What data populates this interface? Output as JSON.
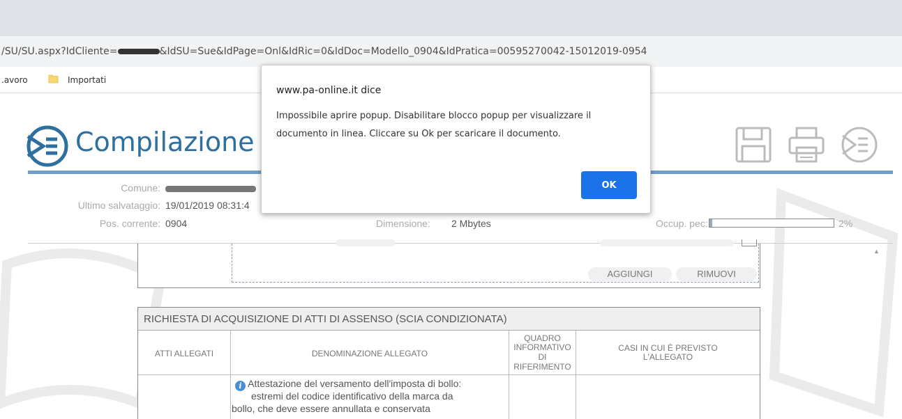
{
  "browser": {
    "url_prefix": "/SU/SU.aspx?IdCliente=",
    "url_suffix": "&IdSU=Sue&IdPage=Onl&IdRic=0&IdDoc=Modello_0904&IdPratica=00595270042-15012019-0954",
    "bookmarks": [
      ".avoro",
      "Importati"
    ]
  },
  "page": {
    "title": "Compilazione i",
    "info": {
      "comune_label": "Comune:",
      "ultimo_label": "Ultimo salvataggio:",
      "ultimo_value": "19/01/2019 08:31:4",
      "pos_label": "Pos. corrente:",
      "pos_value": "0904",
      "dim_label": "Dimensione:",
      "dim_value": "2 Mbytes",
      "occ_label": "Occup. pec:",
      "occ_value": "2%",
      "occ_fraction": 0.02
    },
    "buttons": {
      "add": "AGGIUNGI",
      "remove": "RIMUOVI"
    },
    "table": {
      "title": "RICHIESTA DI ACQUISIZIONE DI ATTI DI ASSENSO (SCIA CONDIZIONATA)",
      "headers": {
        "atti": "ATTI ALLEGATI",
        "denominazione": "DENOMINAZIONE ALLEGATO",
        "quadro_1": "QUADRO",
        "quadro_2": "INFORMATIVO",
        "quadro_3": "DI",
        "quadro_4": "RIFERIMENTO",
        "casi_1": "CASI IN CUI È PREVISTO",
        "casi_2": "L'ALLEGATO"
      },
      "row1": {
        "line1": "Attestazione del versamento dell'imposta di bollo:",
        "line2": "estremi del codice identificativo della marca da",
        "line3": "bollo, che deve essere annullata e conservata"
      }
    }
  },
  "dialog": {
    "title": "www.pa-online.it dice",
    "message_line1": "Impossibile aprire popup. Disabilitare blocco popup per visualizzare il",
    "message_line2": "documento in linea. Cliccare su Ok per scaricare il documento.",
    "ok_label": "OK"
  },
  "colors": {
    "accent": "#2d6f9e",
    "dialog_button": "#1a73e8"
  }
}
